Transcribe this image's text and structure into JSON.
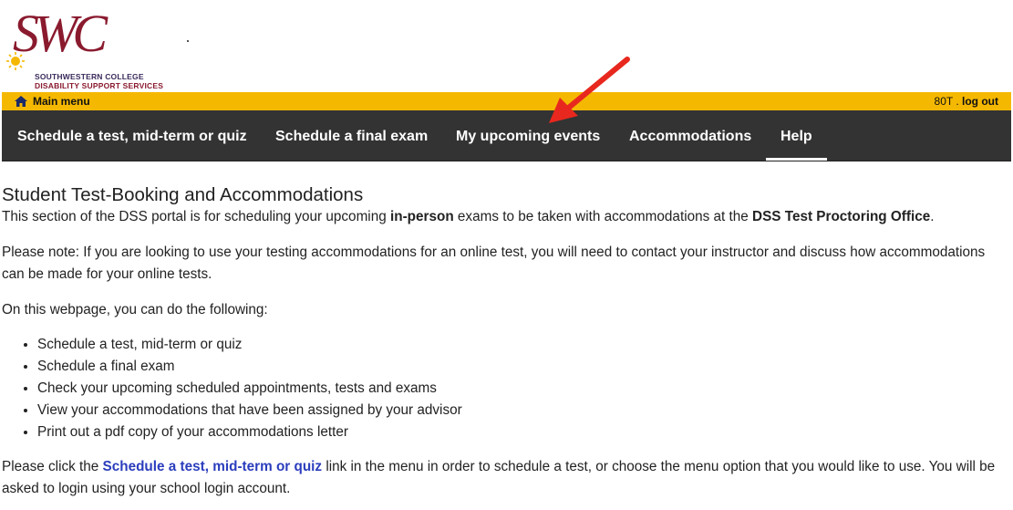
{
  "logo": {
    "script_text": "SWC",
    "line1": "SOUTHWESTERN COLLEGE",
    "line2": "DISABILITY SUPPORT SERVICES"
  },
  "topbar": {
    "main_menu_label": "Main menu",
    "account_id": "80T",
    "separator": " . ",
    "logout_label": "log out",
    "color": "#f5b800"
  },
  "nav": {
    "items": [
      {
        "label": "Schedule a test, mid-term or quiz"
      },
      {
        "label": "Schedule a final exam"
      },
      {
        "label": "My upcoming events"
      },
      {
        "label": "Accommodations"
      },
      {
        "label": "Help",
        "active": true
      }
    ],
    "color": "#333333"
  },
  "content": {
    "title": "Student Test-Booking and Accommodations",
    "intro": {
      "before": "This section of the DSS portal is for scheduling your upcoming ",
      "bold1": "in-person",
      "middle": " exams to be taken with accommodations at the ",
      "bold2": "DSS Test Proctoring Office",
      "after": "."
    },
    "note": "Please note: If you are looking to use your testing accommodations for an online test, you will need to contact your instructor and discuss how accommodations can be made for your online tests.",
    "list_intro": "On this webpage, you can do the following:",
    "list": [
      "Schedule a test, mid-term or quiz",
      "Schedule a final exam",
      "Check your upcoming scheduled appointments, tests and exams",
      "View your accommodations that have been assigned by your advisor",
      "Print out a pdf copy of your accommodations letter"
    ],
    "closing": {
      "before": "Please click the ",
      "link": "Schedule a test, mid-term or quiz",
      "after": " link in the menu in order to schedule a test, or choose the menu option that you would like to use. You will be asked to login using your school login account."
    }
  },
  "annotation": {
    "arrow_color": "#e8281e"
  }
}
